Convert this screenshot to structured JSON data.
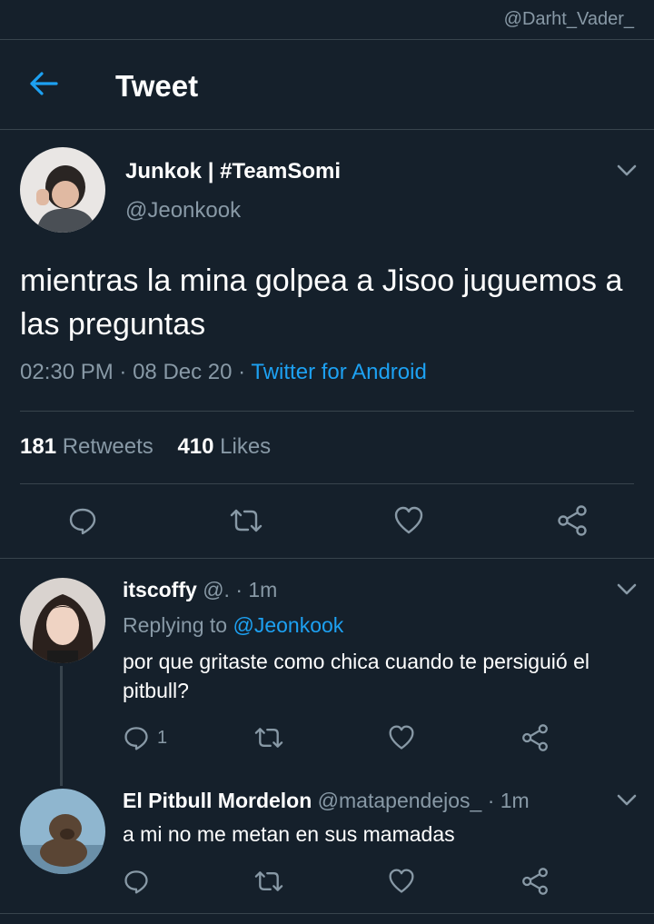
{
  "watermark": "@Darht_Vader_",
  "header": {
    "title": "Tweet"
  },
  "tweet": {
    "author_name": "Junkok | #TeamSomi",
    "author_handle": "@Jeonkook",
    "text": "mientras la mina golpea a Jisoo juguemos a las preguntas",
    "time": "02:30 PM",
    "date": "08 Dec 20",
    "separator": "·",
    "source": "Twitter for Android",
    "retweets_count": "181",
    "retweets_label": "Retweets",
    "likes_count": "410",
    "likes_label": "Likes"
  },
  "replies": [
    {
      "name": "itscoffy",
      "handle": "@.",
      "time": "· 1m",
      "replying_prefix": "Replying to",
      "replying_to": "@Jeonkook",
      "text": "por que gritaste como chica cuando te persiguió el pitbull?",
      "reply_count": "1"
    },
    {
      "name": "El Pitbull Mordelon",
      "handle": "@matapendejos_",
      "time": "· 1m",
      "text": "a mi no me metan en sus mamadas"
    }
  ],
  "colors": {
    "background": "#15202b",
    "accent": "#1da1f2",
    "muted": "#8899a6",
    "divider": "#38444d"
  },
  "icons": [
    "back-arrow-icon",
    "chevron-down-icon",
    "reply-icon",
    "retweet-icon",
    "like-icon",
    "share-icon"
  ]
}
